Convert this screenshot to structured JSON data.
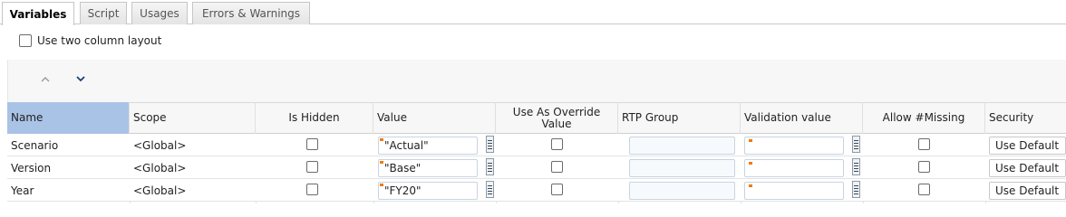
{
  "tabs": [
    {
      "label": "Variables"
    },
    {
      "label": "Script"
    },
    {
      "label": "Usages"
    },
    {
      "label": "Errors & Warnings"
    }
  ],
  "options": {
    "two_column_label": "Use two column layout"
  },
  "columns": {
    "name": "Name",
    "scope": "Scope",
    "is_hidden": "Is Hidden",
    "value": "Value",
    "use_as_override": "Use As Override Value",
    "rtp_group": "RTP Group",
    "validation_value": "Validation value",
    "allow_missing": "Allow #Missing",
    "security": "Security"
  },
  "rows": [
    {
      "name": "Scenario",
      "scope": "<Global>",
      "value": "\"Actual\"",
      "security": "Use Default"
    },
    {
      "name": "Version",
      "scope": "<Global>",
      "value": "\"Base\"",
      "security": "Use Default"
    },
    {
      "name": "Year",
      "scope": "<Global>",
      "value": "\"FY20\"",
      "security": "Use Default"
    }
  ],
  "colors": {
    "selected_header": "#a9c3e6",
    "marker": "#f07c00"
  }
}
